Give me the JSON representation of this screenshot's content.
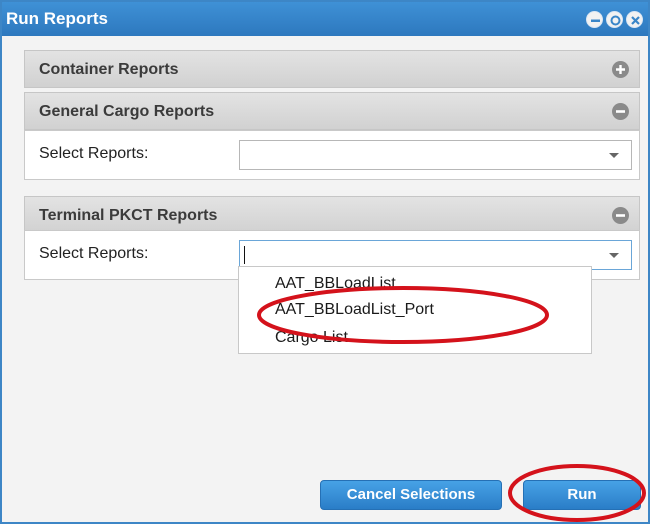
{
  "window": {
    "title": "Run Reports"
  },
  "sections": [
    {
      "title": "Container Reports",
      "state": "collapsed"
    },
    {
      "title": "General Cargo Reports",
      "state": "expanded",
      "field_label": "Select Reports:",
      "value": ""
    },
    {
      "title": "Terminal PKCT Reports",
      "state": "expanded",
      "field_label": "Select Reports:",
      "value": ""
    }
  ],
  "dropdown": {
    "options": [
      "AAT_BBLoadList",
      "AAT_BBLoadList_Port",
      "Cargo List"
    ],
    "circled_option": "AAT_BBLoadList_Port"
  },
  "buttons": {
    "cancel": "Cancel Selections",
    "run": "Run"
  },
  "colors": {
    "titlebar": "#3588cc",
    "button": "#3a90d8",
    "annotation": "#d4121b"
  },
  "icons": {
    "titlebar": [
      "minimize-icon",
      "restore-icon",
      "close-icon"
    ],
    "section_toggles": [
      "plus-icon",
      "minus-icon",
      "minus-icon"
    ]
  }
}
